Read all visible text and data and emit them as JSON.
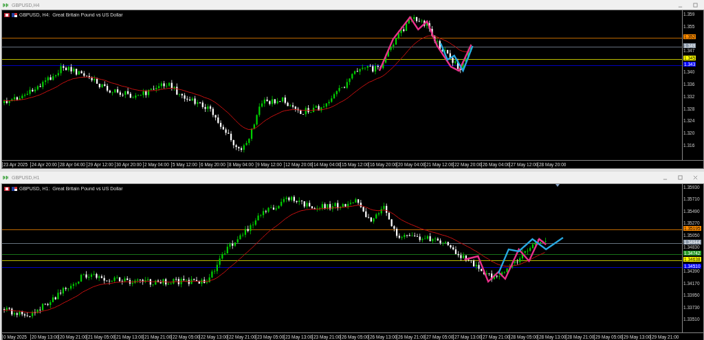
{
  "windows": [
    {
      "title": "GBPUSD,H4",
      "close_button": false,
      "shift_marker": false,
      "chart_label": "GBPUSD, H4:  Great Britain Pound vs US Dollar",
      "price_axis": [
        "1.359",
        "1.355",
        "1.347",
        "1.340",
        "1.336",
        "1.332",
        "1.328",
        "1.324",
        "1.320",
        "1.316"
      ],
      "price_tags": [
        {
          "label": "1.352",
          "color": "#ff8c00"
        },
        {
          "label": "1.349",
          "color": "#8a98a8"
        },
        {
          "label": "1.345",
          "color": "#ffff00"
        },
        {
          "label": "1.343",
          "color": "#0000ff"
        }
      ],
      "time_axis": [
        "23 Apr 2025",
        "24 Apr 20:00",
        "28 Apr 04:00",
        "29 Apr 12:00",
        "30 Apr 20:00",
        "2 May 04:00",
        "5 May 12:00",
        "6 May 20:00",
        "8 May 04:00",
        "9 May 12:00",
        "12 May 20:00",
        "14 May 04:00",
        "15 May 12:00",
        "16 May 20:00",
        "20 May 04:00",
        "21 May 12:00",
        "22 May 20:00",
        "26 May 04:00",
        "27 May 12:00",
        "28 May 20:00"
      ]
    },
    {
      "title": "GBPUSD,H1",
      "close_button": true,
      "shift_marker": true,
      "chart_label": "GBPUSD, H1:  Great Britain Pound vs US Dollar",
      "price_axis": [
        "1.35930",
        "1.35710",
        "1.35490",
        "1.35270",
        "1.35050",
        "1.34830",
        "1.34390",
        "1.34170",
        "1.33950",
        "1.33730",
        "1.33510"
      ],
      "price_tags": [
        {
          "label": "1.35195",
          "color": "#ff8c00"
        },
        {
          "label": "1.34944",
          "color": "#8a98a8"
        },
        {
          "label": "1.34742",
          "color": "#229922"
        },
        {
          "label": "1.34638",
          "color": "#ffff00"
        },
        {
          "label": "1.34510",
          "color": "#0000ff"
        }
      ],
      "time_axis": [
        "0 May 2025",
        "20 May 13:00",
        "20 May 21:00",
        "21 May 05:00",
        "21 May 13:00",
        "21 May 21:00",
        "22 May 05:00",
        "22 May 13:00",
        "22 May 21:00",
        "23 May 05:00",
        "23 May 13:00",
        "23 May 21:00",
        "26 May 05:00",
        "26 May 13:00",
        "26 May 21:00",
        "27 May 05:00",
        "27 May 13:00",
        "27 May 21:00",
        "28 May 05:00",
        "28 May 13:00",
        "28 May 21:00",
        "29 May 05:00",
        "29 May 13:00",
        "29 May 21:00"
      ]
    }
  ]
}
